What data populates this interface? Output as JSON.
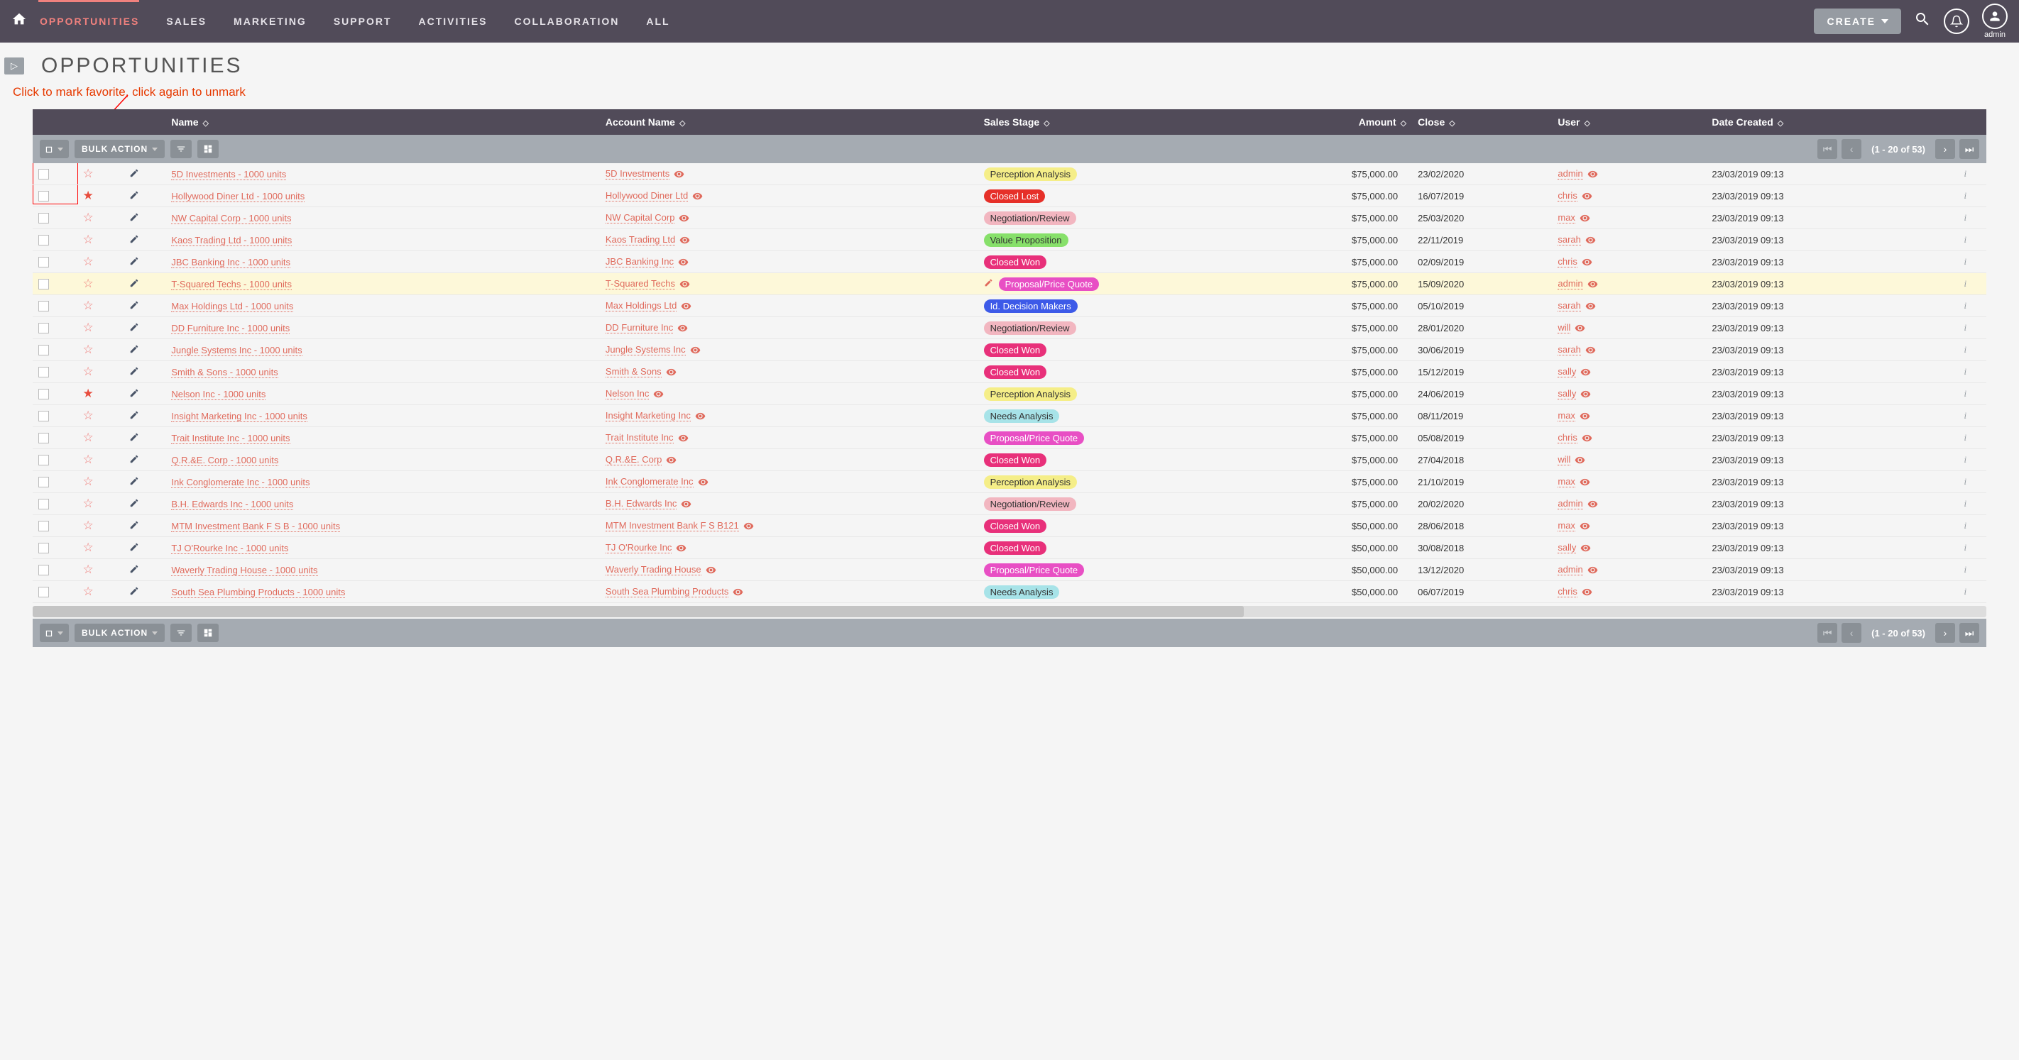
{
  "nav": {
    "items": [
      "OPPORTUNITIES",
      "SALES",
      "MARKETING",
      "SUPPORT",
      "ACTIVITIES",
      "COLLABORATION",
      "ALL"
    ],
    "activeIndex": 0,
    "createLabel": "CREATE",
    "userLabel": "admin"
  },
  "page": {
    "title": "OPPORTUNITIES",
    "annotation": "Click to mark favorite, click again to unmark"
  },
  "columns": {
    "name": "Name",
    "account": "Account Name",
    "stage": "Sales Stage",
    "amount": "Amount",
    "close": "Close",
    "user": "User",
    "created": "Date Created"
  },
  "toolbar": {
    "bulk": "BULK ACTION",
    "pager": "(1 - 20 of 53)"
  },
  "stageStyles": {
    "Perception Analysis": "pill-yellow",
    "Closed Lost": "pill-redfill",
    "Negotiation/Review": "pill-pink",
    "Value Proposition": "pill-green",
    "Closed Won": "pill-magenta",
    "Proposal/Price Quote": "pill-hotpink",
    "Id. Decision Makers": "pill-blue",
    "Needs Analysis": "pill-cyan"
  },
  "rows": [
    {
      "fav": false,
      "name": "5D Investments - 1000 units",
      "account": "5D Investments",
      "stage": "Perception Analysis",
      "amount": "$75,000.00",
      "close": "23/02/2020",
      "user": "admin",
      "created": "23/03/2019 09:13"
    },
    {
      "fav": true,
      "name": "Hollywood Diner Ltd - 1000 units",
      "account": "Hollywood Diner Ltd",
      "stage": "Closed Lost",
      "amount": "$75,000.00",
      "close": "16/07/2019",
      "user": "chris",
      "created": "23/03/2019 09:13"
    },
    {
      "fav": false,
      "name": "NW Capital Corp - 1000 units",
      "account": "NW Capital Corp",
      "stage": "Negotiation/Review",
      "amount": "$75,000.00",
      "close": "25/03/2020",
      "user": "max",
      "created": "23/03/2019 09:13"
    },
    {
      "fav": false,
      "name": "Kaos Trading Ltd - 1000 units",
      "account": "Kaos Trading Ltd",
      "stage": "Value Proposition",
      "amount": "$75,000.00",
      "close": "22/11/2019",
      "user": "sarah",
      "created": "23/03/2019 09:13"
    },
    {
      "fav": false,
      "name": "JBC Banking Inc - 1000 units",
      "account": "JBC Banking Inc",
      "stage": "Closed Won",
      "amount": "$75,000.00",
      "close": "02/09/2019",
      "user": "chris",
      "created": "23/03/2019 09:13"
    },
    {
      "fav": false,
      "hl": true,
      "editable": true,
      "name": "T-Squared Techs - 1000 units",
      "account": "T-Squared Techs",
      "stage": "Proposal/Price Quote",
      "amount": "$75,000.00",
      "close": "15/09/2020",
      "user": "admin",
      "created": "23/03/2019 09:13"
    },
    {
      "fav": false,
      "name": "Max Holdings Ltd - 1000 units",
      "account": "Max Holdings Ltd",
      "stage": "Id. Decision Makers",
      "amount": "$75,000.00",
      "close": "05/10/2019",
      "user": "sarah",
      "created": "23/03/2019 09:13"
    },
    {
      "fav": false,
      "name": "DD Furniture Inc - 1000 units",
      "account": "DD Furniture Inc",
      "stage": "Negotiation/Review",
      "amount": "$75,000.00",
      "close": "28/01/2020",
      "user": "will",
      "created": "23/03/2019 09:13"
    },
    {
      "fav": false,
      "name": "Jungle Systems Inc - 1000 units",
      "account": "Jungle Systems Inc",
      "stage": "Closed Won",
      "amount": "$75,000.00",
      "close": "30/06/2019",
      "user": "sarah",
      "created": "23/03/2019 09:13"
    },
    {
      "fav": false,
      "name": "Smith & Sons - 1000 units",
      "account": "Smith & Sons",
      "stage": "Closed Won",
      "amount": "$75,000.00",
      "close": "15/12/2019",
      "user": "sally",
      "created": "23/03/2019 09:13"
    },
    {
      "fav": true,
      "name": "Nelson Inc - 1000 units",
      "account": "Nelson Inc",
      "stage": "Perception Analysis",
      "amount": "$75,000.00",
      "close": "24/06/2019",
      "user": "sally",
      "created": "23/03/2019 09:13"
    },
    {
      "fav": false,
      "name": "Insight Marketing Inc - 1000 units",
      "account": "Insight Marketing Inc",
      "stage": "Needs Analysis",
      "amount": "$75,000.00",
      "close": "08/11/2019",
      "user": "max",
      "created": "23/03/2019 09:13"
    },
    {
      "fav": false,
      "name": "Trait Institute Inc - 1000 units",
      "account": "Trait Institute Inc",
      "stage": "Proposal/Price Quote",
      "amount": "$75,000.00",
      "close": "05/08/2019",
      "user": "chris",
      "created": "23/03/2019 09:13"
    },
    {
      "fav": false,
      "name": "Q.R.&E. Corp - 1000 units",
      "account": "Q.R.&E. Corp",
      "stage": "Closed Won",
      "amount": "$75,000.00",
      "close": "27/04/2018",
      "user": "will",
      "created": "23/03/2019 09:13"
    },
    {
      "fav": false,
      "name": "Ink Conglomerate Inc - 1000 units",
      "account": "Ink Conglomerate Inc",
      "stage": "Perception Analysis",
      "amount": "$75,000.00",
      "close": "21/10/2019",
      "user": "max",
      "created": "23/03/2019 09:13"
    },
    {
      "fav": false,
      "name": "B.H. Edwards Inc - 1000 units",
      "account": "B.H. Edwards Inc",
      "stage": "Negotiation/Review",
      "amount": "$75,000.00",
      "close": "20/02/2020",
      "user": "admin",
      "created": "23/03/2019 09:13"
    },
    {
      "fav": false,
      "name": "MTM Investment Bank F S B - 1000 units",
      "account": "MTM Investment Bank F S B121",
      "stage": "Closed Won",
      "amount": "$50,000.00",
      "close": "28/06/2018",
      "user": "max",
      "created": "23/03/2019 09:13"
    },
    {
      "fav": false,
      "name": "TJ O'Rourke Inc - 1000 units",
      "account": "TJ O'Rourke Inc",
      "stage": "Closed Won",
      "amount": "$50,000.00",
      "close": "30/08/2018",
      "user": "sally",
      "created": "23/03/2019 09:13"
    },
    {
      "fav": false,
      "name": "Waverly Trading House - 1000 units",
      "account": "Waverly Trading House",
      "stage": "Proposal/Price Quote",
      "amount": "$50,000.00",
      "close": "13/12/2020",
      "user": "admin",
      "created": "23/03/2019 09:13"
    },
    {
      "fav": false,
      "name": "South Sea Plumbing Products - 1000 units",
      "account": "South Sea Plumbing Products",
      "stage": "Needs Analysis",
      "amount": "$50,000.00",
      "close": "06/07/2019",
      "user": "chris",
      "created": "23/03/2019 09:13"
    }
  ]
}
